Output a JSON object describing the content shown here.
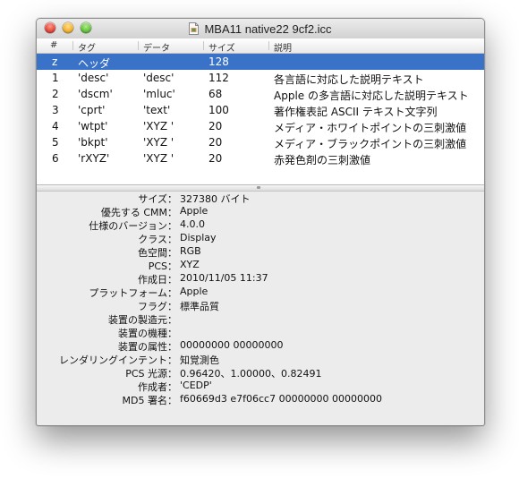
{
  "window": {
    "title": "MBA11 native22 9cf2.icc"
  },
  "table": {
    "headers": {
      "num": "#",
      "tag": "タグ",
      "data": "データ",
      "size": "サイズ",
      "desc": "説明"
    },
    "rows": [
      {
        "num": "z",
        "tag": "ヘッダ",
        "data": "",
        "size": "128",
        "desc": "",
        "selected": true
      },
      {
        "num": "1",
        "tag": "'desc'",
        "data": "'desc'",
        "size": "112",
        "desc": "各言語に対応した説明テキスト"
      },
      {
        "num": "2",
        "tag": "'dscm'",
        "data": "'mluc'",
        "size": "68",
        "desc": "Apple の多言語に対応した説明テキスト"
      },
      {
        "num": "3",
        "tag": "'cprt'",
        "data": "'text'",
        "size": "100",
        "desc": "著作権表記 ASCII テキスト文字列"
      },
      {
        "num": "4",
        "tag": "'wtpt'",
        "data": "'XYZ '",
        "size": "20",
        "desc": "メディア・ホワイトポイントの三刺激値"
      },
      {
        "num": "5",
        "tag": "'bkpt'",
        "data": "'XYZ '",
        "size": "20",
        "desc": "メディア・ブラックポイントの三刺激値"
      },
      {
        "num": "6",
        "tag": "'rXYZ'",
        "data": "'XYZ '",
        "size": "20",
        "desc": "赤発色剤の三刺激値"
      }
    ]
  },
  "info": [
    {
      "label": "サイズ：",
      "value": "327380 バイト"
    },
    {
      "label": "優先する CMM：",
      "value": "Apple"
    },
    {
      "label": "仕様のバージョン：",
      "value": "4.0.0"
    },
    {
      "label": "クラス：",
      "value": "Display"
    },
    {
      "label": "色空間：",
      "value": "RGB"
    },
    {
      "label": "PCS：",
      "value": "XYZ"
    },
    {
      "label": "作成日：",
      "value": "2010/11/05 11:37"
    },
    {
      "label": "プラットフォーム：",
      "value": "Apple"
    },
    {
      "label": "フラグ：",
      "value": "標準品質"
    },
    {
      "label": "装置の製造元：",
      "value": ""
    },
    {
      "label": "装置の機種：",
      "value": ""
    },
    {
      "label": "装置の属性：",
      "value": "00000000 00000000"
    },
    {
      "label": "レンダリングインテント：",
      "value": "知覚測色"
    },
    {
      "label": "PCS 光源：",
      "value": "0.96420、1.00000、0.82491"
    },
    {
      "label": "作成者：",
      "value": "'CEDP'"
    },
    {
      "label": "MD5 署名：",
      "value": "f60669d3 e7f06cc7 00000000 00000000"
    }
  ],
  "colors": {
    "selection": "#3a72c7",
    "window_bg": "#ececec"
  },
  "icons": {
    "title": "document-icon",
    "splitter": "grip-icon"
  }
}
